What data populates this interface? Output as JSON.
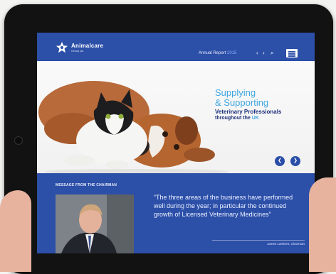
{
  "brand": {
    "name": "Animalcare",
    "subtitle": "Group plc"
  },
  "header": {
    "annual_report_label": "Annual Report",
    "annual_report_year": "2015",
    "prev_icon": "chevron-left-icon",
    "next_icon": "chevron-right-icon",
    "search_icon": "search-icon",
    "menu_icon": "menu-icon"
  },
  "hero": {
    "line1": "Supplying",
    "line2": "& Supporting",
    "line3": "Veterinary Professionals",
    "line4_prefix": "throughout the ",
    "line4_highlight": "UK",
    "slide_active": 1,
    "slide_count": 2
  },
  "chairman": {
    "section_title": "MESSAGE FROM THE CHAIRMAN",
    "quote": "“The three areas of the business have performed well during the year; in particular the continued growth of Licensed Veterinary Medicines”",
    "attribution": "James Lambert, Chairman"
  },
  "colors": {
    "brand_blue": "#2c4fa8",
    "accent_cyan": "#3fa6e0",
    "dark_navy": "#1b2f78"
  }
}
